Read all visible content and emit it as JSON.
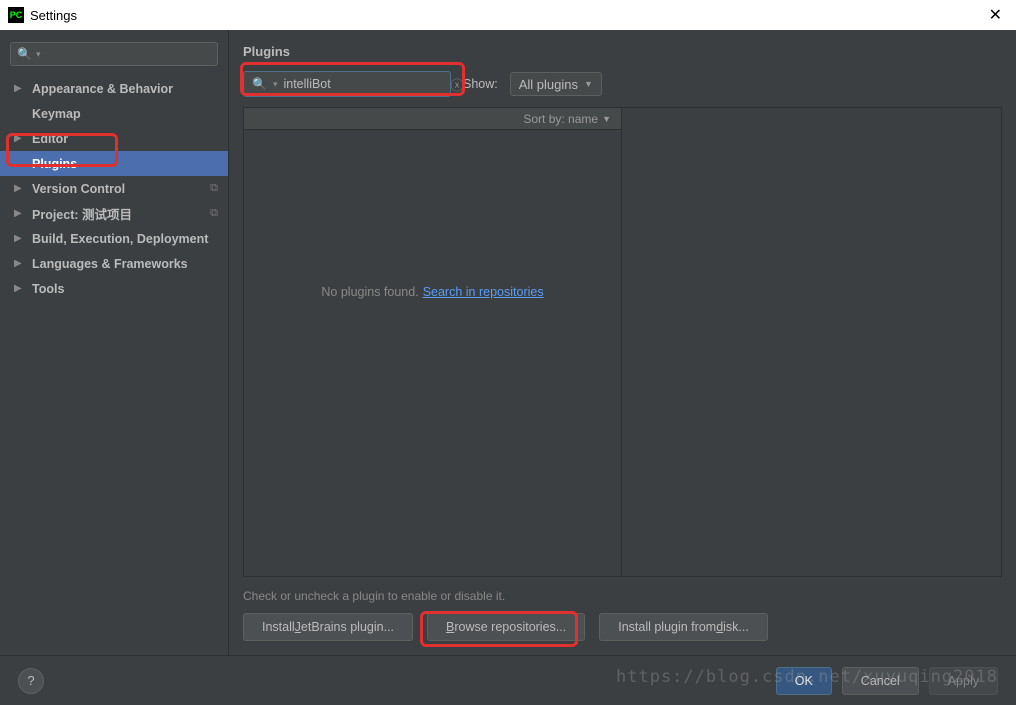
{
  "window": {
    "title": "Settings",
    "app_icon_label": "PC"
  },
  "sidebar": {
    "items": [
      {
        "label": "Appearance & Behavior",
        "expandable": true
      },
      {
        "label": "Keymap",
        "expandable": false
      },
      {
        "label": "Editor",
        "expandable": true
      },
      {
        "label": "Plugins",
        "expandable": false,
        "selected": true
      },
      {
        "label": "Version Control",
        "expandable": true,
        "has_icon": true
      },
      {
        "label": "Project: 测试项目",
        "expandable": true,
        "has_icon": true
      },
      {
        "label": "Build, Execution, Deployment",
        "expandable": true
      },
      {
        "label": "Languages & Frameworks",
        "expandable": true
      },
      {
        "label": "Tools",
        "expandable": true
      }
    ]
  },
  "main": {
    "title": "Plugins",
    "search_value": "intelliBot",
    "show_label": "Show:",
    "show_dropdown": "All plugins",
    "sort_label": "Sort by: name",
    "empty_text": "No plugins found.",
    "empty_link": "Search in repositories",
    "hint": "Check or uncheck a plugin to enable or disable it.",
    "buttons": {
      "b1_pre": "Install ",
      "b1_ul": "J",
      "b1_post": "etBrains plugin...",
      "b2_ul": "B",
      "b2_post": "rowse repositories...",
      "b3_pre": "Install plugin from ",
      "b3_ul": "d",
      "b3_post": "isk..."
    }
  },
  "footer": {
    "ok": "OK",
    "cancel": "Cancel",
    "apply": "Apply"
  },
  "watermark": "https://blog.csdn.net/xuyuqing2018"
}
